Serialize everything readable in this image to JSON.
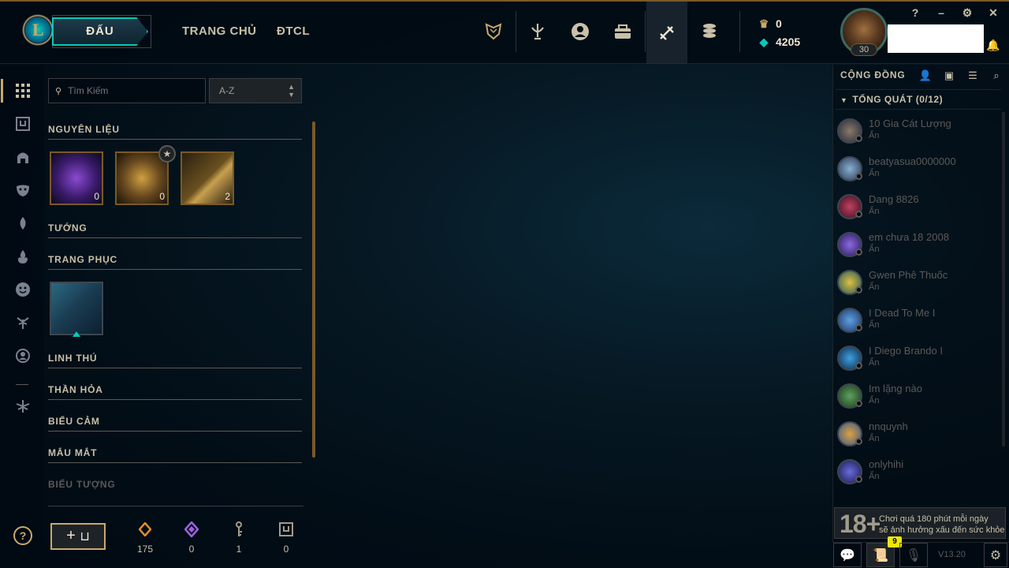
{
  "topbar": {
    "play_label": "ĐẤU",
    "nav": [
      "TRANG CHỦ",
      "ĐTCL"
    ],
    "currency": {
      "orange_essence": "0",
      "blue_essence": "4205"
    },
    "profile": {
      "level": "30"
    },
    "window_buttons": [
      "?",
      "–",
      "⚙",
      "✕"
    ]
  },
  "inventory": {
    "search_placeholder": "Tìm Kiếm",
    "sort_value": "A-Z",
    "sections": {
      "materials": "NGUYÊN LIỆU",
      "champions": "TƯỚNG",
      "skins": "TRANG PHỤC",
      "wards": "LINH THÚ",
      "totems": "THẦN HỎA",
      "emotes": "BIỂU CẢM",
      "eye_colors": "MẮU MẮT",
      "icons": "BIỂU TƯỢNG"
    },
    "materials": [
      {
        "name": "mythic-essence",
        "count": "0"
      },
      {
        "name": "chest",
        "count": "0"
      },
      {
        "name": "key",
        "count": "2"
      }
    ],
    "bottom_counts": [
      {
        "icon": "orange-essence-icon",
        "value": "175"
      },
      {
        "icon": "mythic-essence-icon",
        "value": "0"
      },
      {
        "icon": "key-fragment-icon",
        "value": "1"
      },
      {
        "icon": "chest-icon",
        "value": "0"
      }
    ],
    "help_label": "?",
    "craft_label": "+"
  },
  "social": {
    "title": "CỘNG ĐỒNG",
    "group_label": "TỔNG QUÁT (0/12)",
    "friends": [
      {
        "name": "10 Gia Cát Lượng",
        "status": "Ẩn"
      },
      {
        "name": "beatyasua0000000",
        "status": "Ẩn"
      },
      {
        "name": "Dang 8826",
        "status": "Ẩn"
      },
      {
        "name": "em chưa 18 2008",
        "status": "Ẩn"
      },
      {
        "name": "Gwen Phê Thuốc",
        "status": "Ẩn"
      },
      {
        "name": "I Dead To Me I",
        "status": "Ẩn"
      },
      {
        "name": "I Diego Brando I",
        "status": "Ẩn"
      },
      {
        "name": "Im lặng nào",
        "status": "Ẩn"
      },
      {
        "name": "nnquynh",
        "status": "Ẩn"
      },
      {
        "name": "onlyhihi",
        "status": "Ẩn"
      }
    ],
    "age_rating": "18+",
    "notice_line1": "Chơi quá 180 phút mỗi ngày",
    "notice_line2": "sẽ ảnh hưởng xấu đến sức khỏe",
    "mission_badge": "9",
    "version": "V13.20"
  },
  "colors": {
    "gold": "#c8aa6e",
    "teal": "#0ac8b9",
    "bg": "#010a13"
  }
}
